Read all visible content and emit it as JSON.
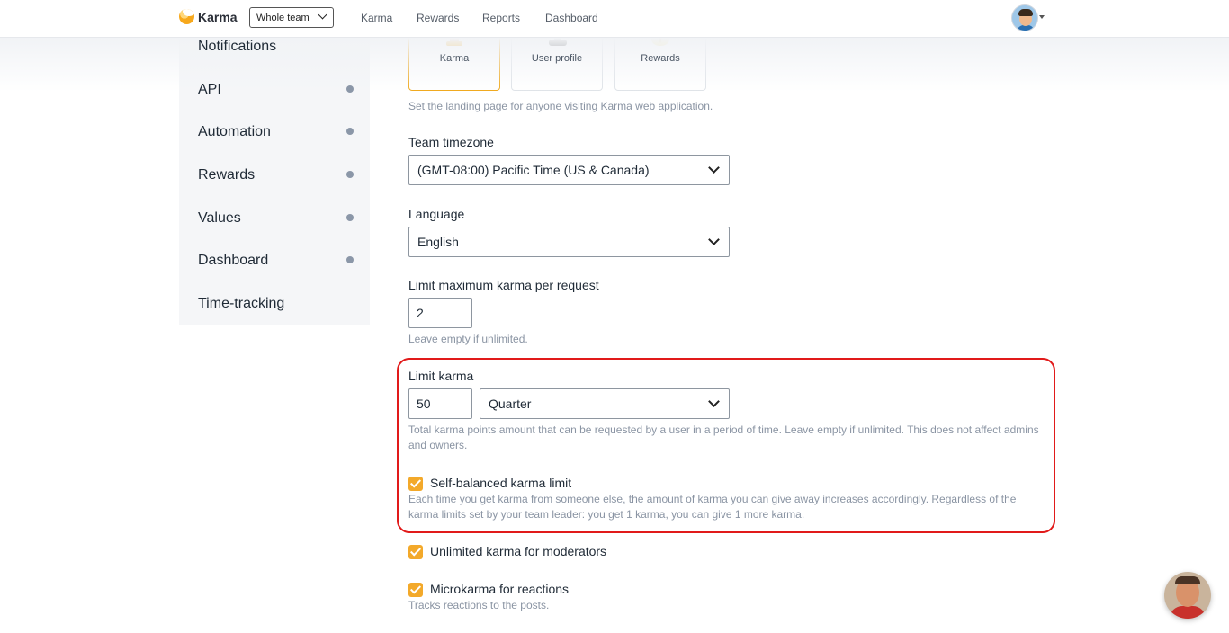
{
  "header": {
    "logo_text": "Karma",
    "team_select": "Whole team",
    "nav": [
      "Karma",
      "Rewards",
      "Reports",
      "Dashboard"
    ]
  },
  "sidebar": {
    "items": [
      {
        "label": "Notifications",
        "dot": false
      },
      {
        "label": "API",
        "dot": true
      },
      {
        "label": "Automation",
        "dot": true
      },
      {
        "label": "Rewards",
        "dot": true
      },
      {
        "label": "Values",
        "dot": true
      },
      {
        "label": "Dashboard",
        "dot": true
      },
      {
        "label": "Time-tracking",
        "dot": false
      }
    ]
  },
  "landing": {
    "tiles": [
      {
        "label": "Karma",
        "icon": "karma-icon",
        "selected": true
      },
      {
        "label": "User profile",
        "icon": "user-profile-icon",
        "selected": false
      },
      {
        "label": "Rewards",
        "icon": "rewards-icon",
        "selected": false
      }
    ],
    "help": "Set the landing page for anyone visiting Karma web application."
  },
  "timezone": {
    "label": "Team timezone",
    "value": "(GMT-08:00) Pacific Time (US & Canada)"
  },
  "language": {
    "label": "Language",
    "value": "English"
  },
  "max_per_request": {
    "label": "Limit maximum karma per request",
    "value": "2",
    "help": "Leave empty if unlimited."
  },
  "limit_karma": {
    "label": "Limit karma",
    "amount": "50",
    "period": "Quarter",
    "help": "Total karma points amount that can be requested by a user in a period of time. Leave empty if unlimited. This does not affect admins and owners."
  },
  "self_balanced": {
    "label": "Self-balanced karma limit",
    "checked": true,
    "help": "Each time you get karma from someone else, the amount of karma you can give away increases accordingly. Regardless of the karma limits set by your team leader: you get 1 karma, you can give 1 more karma."
  },
  "unlimited_moderators": {
    "label": "Unlimited karma for moderators",
    "checked": true
  },
  "microkarma": {
    "label": "Microkarma for reactions",
    "checked": true,
    "help": "Tracks reactions to the posts."
  },
  "colors": {
    "accent": "#f3a92a",
    "highlight": "#e11a1a"
  }
}
